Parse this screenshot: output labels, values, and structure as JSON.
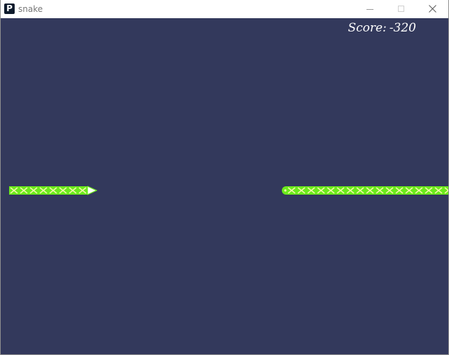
{
  "window": {
    "title": "snake",
    "app_icon_glyph": "P",
    "app_icon": "app-logo-icon",
    "controls": [
      "minimize-icon",
      "maximize-icon",
      "close-icon"
    ]
  },
  "game": {
    "score_label": "Score:",
    "score_value": "-320",
    "background_color": "#33395c",
    "snake_body_color": "#6bea1c",
    "snake_pattern_color": "#f3f7a8",
    "snake_head_color": "#ffffff",
    "snake_left_part": {
      "segments": 8,
      "head_direction": "right"
    },
    "snake_right_part": {
      "segments": 17,
      "tail_end": "left"
    }
  }
}
